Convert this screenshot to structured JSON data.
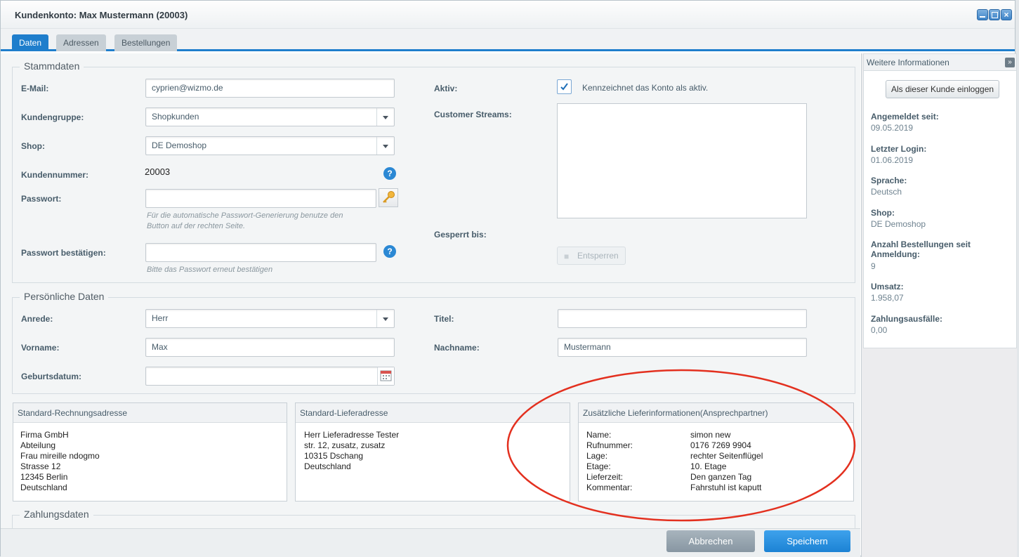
{
  "window": {
    "title": "Kundenkonto: Max Mustermann (20003)"
  },
  "tabs": [
    {
      "label": "Daten"
    },
    {
      "label": "Adressen"
    },
    {
      "label": "Bestellungen"
    }
  ],
  "stammdaten": {
    "legend": "Stammdaten",
    "email_label": "E-Mail:",
    "email_value": "cyprien@wizmo.de",
    "kundengruppe_label": "Kundengruppe:",
    "kundengruppe_value": "Shopkunden",
    "shop_label": "Shop:",
    "shop_value": "DE Demoshop",
    "kundennummer_label": "Kundennummer:",
    "kundennummer_value": "20003",
    "passwort_label": "Passwort:",
    "passwort_hint_1": "Für die automatische Passwort-Generierung benutze den",
    "passwort_hint_2": "Button auf der rechten Seite.",
    "passwort_confirm_label": "Passwort bestätigen:",
    "passwort_confirm_hint": "Bitte das Passwort erneut bestätigen",
    "aktiv_label": "Aktiv:",
    "aktiv_checked": true,
    "aktiv_text": "Kennzeichnet das Konto als aktiv.",
    "streams_label": "Customer Streams:",
    "gesperrt_label": "Gesperrt bis:",
    "entsperren_label": "Entsperren",
    "help_glyph": "?"
  },
  "persoenlich": {
    "legend": "Persönliche Daten",
    "anrede_label": "Anrede:",
    "anrede_value": "Herr",
    "titel_label": "Titel:",
    "titel_value": "",
    "vorname_label": "Vorname:",
    "vorname_value": "Max",
    "nachname_label": "Nachname:",
    "nachname_value": "Mustermann",
    "geburtsdatum_label": "Geburtsdatum:",
    "geburtsdatum_value": ""
  },
  "rechnungsadresse": {
    "title": "Standard-Rechnungsadresse",
    "lines": [
      "Firma GmbH",
      "Abteilung",
      "Frau mireille ndogmo",
      "Strasse 12",
      "12345 Berlin",
      "Deutschland"
    ]
  },
  "lieferadresse": {
    "title": "Standard-Lieferadresse",
    "lines": [
      "Herr Lieferadresse Tester",
      "str. 12, zusatz, zusatz",
      "10315 Dschang",
      "Deutschland"
    ]
  },
  "zusatzinfo": {
    "title": "Zusätzliche Lieferinformationen(Ansprechpartner)",
    "rows": [
      {
        "key": "Name:",
        "value": "simon new"
      },
      {
        "key": "Rufnummer:",
        "value": "0176 7269 9904"
      },
      {
        "key": "Lage:",
        "value": "rechter Seitenflügel"
      },
      {
        "key": "Etage:",
        "value": "10. Etage"
      },
      {
        "key": "Lieferzeit:",
        "value": "Den ganzen Tag"
      },
      {
        "key": "Kommentar:",
        "value": "Fahrstuhl ist kaputt"
      }
    ],
    "highlight_color": "#e3301f"
  },
  "zahlung": {
    "legend": "Zahlungsdaten"
  },
  "sidebar": {
    "title": "Weitere Informationen",
    "toggle_glyph": "»",
    "login_button": "Als dieser Kunde einloggen",
    "items": [
      {
        "label": "Angemeldet seit:",
        "value": "09.05.2019"
      },
      {
        "label": "Letzter Login:",
        "value": "01.06.2019"
      },
      {
        "label": "Sprache:",
        "value": "Deutsch"
      },
      {
        "label": "Shop:",
        "value": "DE Demoshop"
      },
      {
        "label": "Anzahl Bestellungen seit Anmeldung:",
        "value": "9"
      },
      {
        "label": "Umsatz:",
        "value": "1.958,07"
      },
      {
        "label": "Zahlungsausfälle:",
        "value": "0,00"
      }
    ]
  },
  "footer": {
    "cancel": "Abbrechen",
    "save": "Speichern"
  },
  "colors": {
    "accent": "#1f7ecc",
    "save": "#2a8fe0",
    "cancel": "#95a3ae"
  }
}
